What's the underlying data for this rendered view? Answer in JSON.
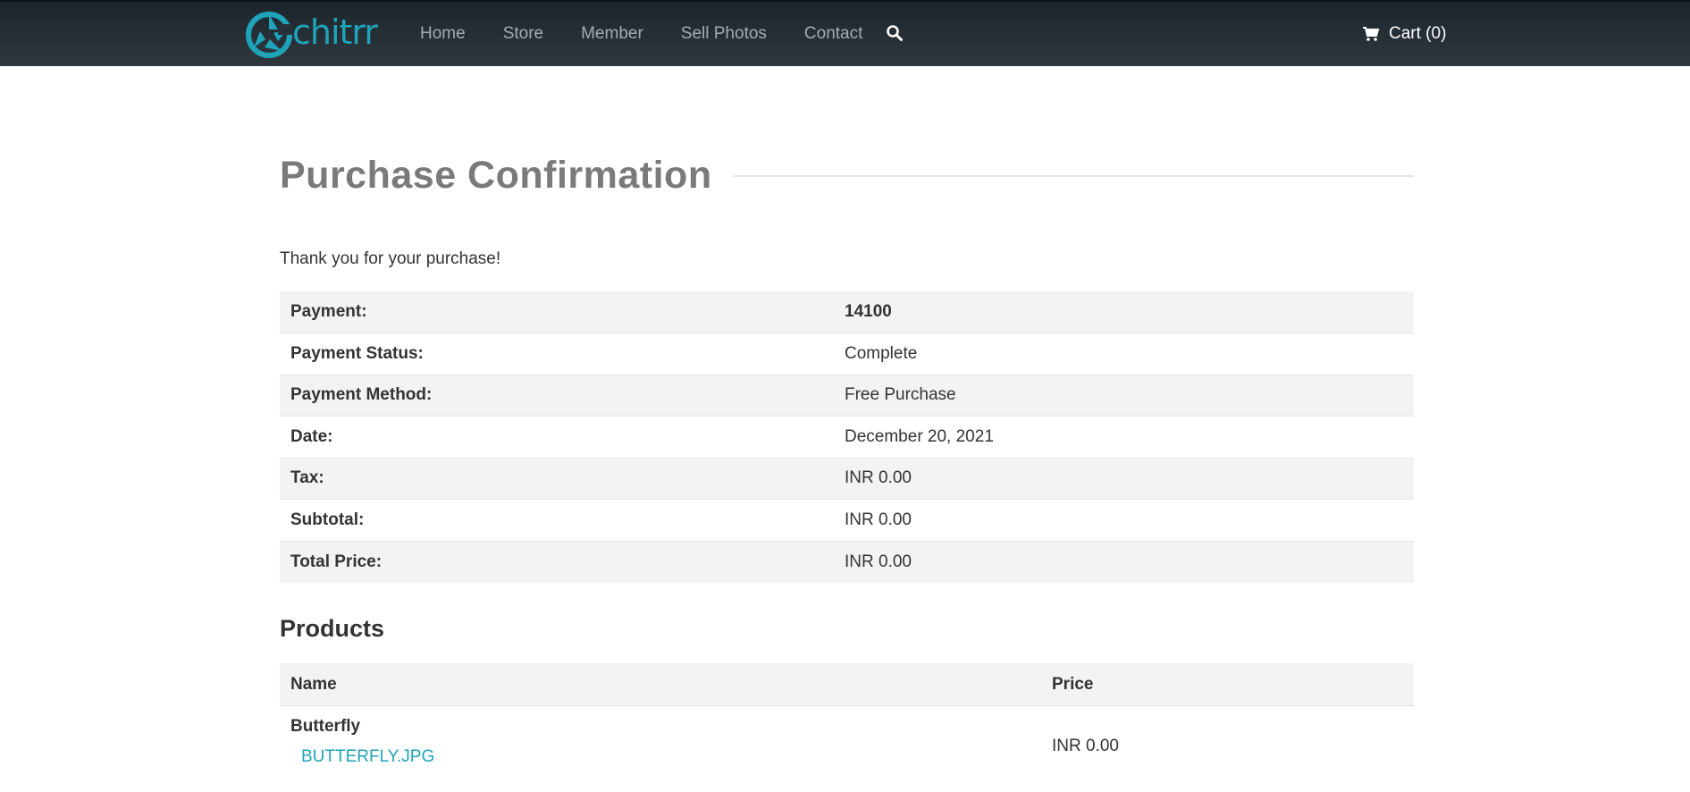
{
  "header": {
    "logo_text": "chitrr",
    "nav": [
      "Home",
      "Store",
      "Member",
      "Sell Photos",
      "Contact"
    ],
    "cart_label": "Cart (0)"
  },
  "colors": {
    "brand": "#1fa3b8",
    "header_bg": "#252e35",
    "title_gray": "#7a7a7a",
    "row_stripe": "#f3f3f3"
  },
  "icons": {
    "search": "search-icon",
    "cart": "cart-icon",
    "logo": "aperture-logo-icon"
  },
  "page": {
    "title": "Purchase Confirmation",
    "thanks": "Thank you for your purchase!"
  },
  "details": [
    {
      "label": "Payment:",
      "value": "14100"
    },
    {
      "label": "Payment Status:",
      "value": "Complete"
    },
    {
      "label": "Payment Method:",
      "value": "Free Purchase"
    },
    {
      "label": "Date:",
      "value": "December 20, 2021"
    },
    {
      "label": "Tax:",
      "value": "INR 0.00"
    },
    {
      "label": "Subtotal:",
      "value": "INR 0.00"
    },
    {
      "label": "Total Price:",
      "value": "INR 0.00"
    }
  ],
  "products": {
    "heading": "Products",
    "columns": [
      "Name",
      "Price"
    ],
    "rows": [
      {
        "name": "Butterfly",
        "file": "BUTTERFLY.JPG",
        "price": "INR 0.00"
      }
    ]
  }
}
